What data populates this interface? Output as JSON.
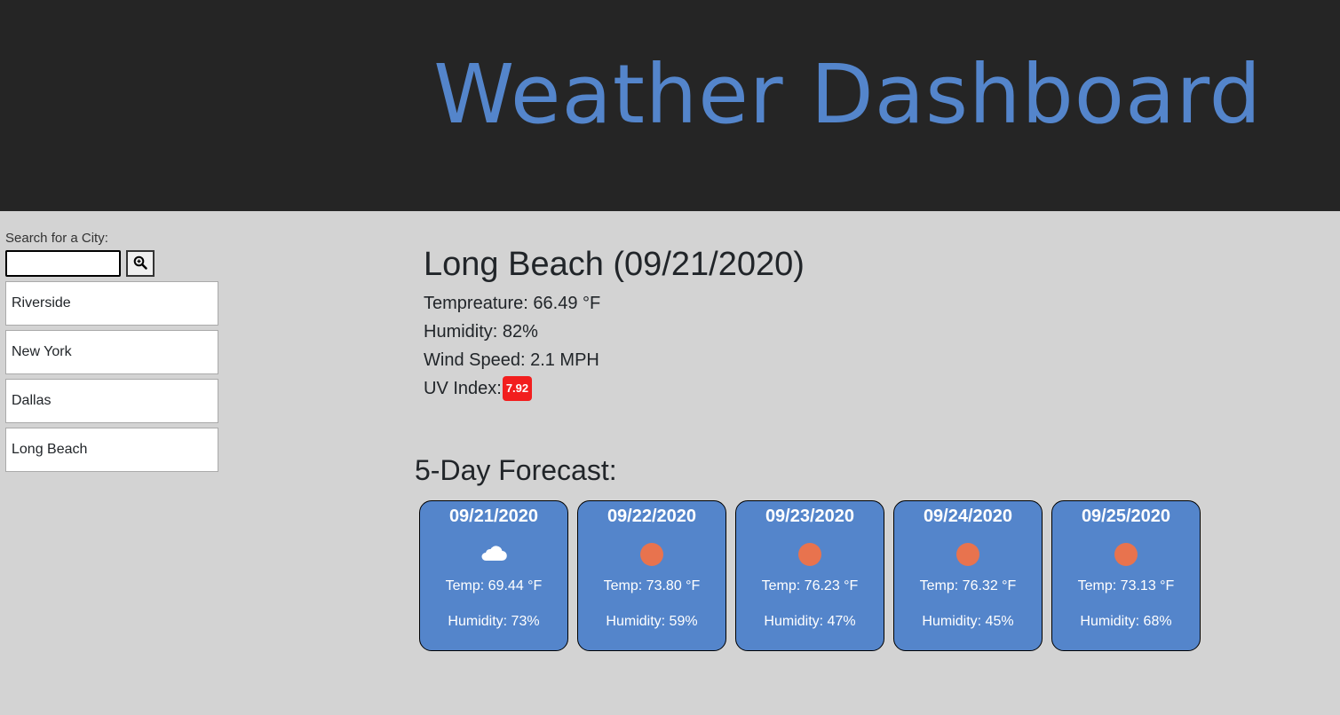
{
  "colors": {
    "header_bg": "#252525",
    "title": "#5485cb",
    "card_bg": "#5485cb",
    "uv_badge": "#f21e1e",
    "sun": "#e8734e",
    "page_bg": "#d3d3d3"
  },
  "header": {
    "title": "Weather Dashboard"
  },
  "search": {
    "label": "Search for a City:",
    "value": "",
    "placeholder": "",
    "button_icon": "search-icon"
  },
  "history": [
    "Riverside",
    "New York",
    "Dallas",
    "Long Beach"
  ],
  "current": {
    "heading": "Long Beach (09/21/2020)",
    "temperature": "Tempreature: 66.49 °F",
    "humidity": "Humidity: 82%",
    "wind": "Wind Speed: 2.1 MPH",
    "uv_label": "UV Index:",
    "uv_value": "7.92"
  },
  "forecast": {
    "title": "5-Day Forecast:",
    "days": [
      {
        "date": "09/21/2020",
        "icon": "cloud-icon",
        "temp": "Temp: 69.44 °F",
        "humidity": "Humidity: 73%"
      },
      {
        "date": "09/22/2020",
        "icon": "sun-icon",
        "temp": "Temp: 73.80 °F",
        "humidity": "Humidity: 59%"
      },
      {
        "date": "09/23/2020",
        "icon": "sun-icon",
        "temp": "Temp: 76.23 °F",
        "humidity": "Humidity: 47%"
      },
      {
        "date": "09/24/2020",
        "icon": "sun-icon",
        "temp": "Temp: 76.32 °F",
        "humidity": "Humidity: 45%"
      },
      {
        "date": "09/25/2020",
        "icon": "sun-icon",
        "temp": "Temp: 73.13 °F",
        "humidity": "Humidity: 68%"
      }
    ]
  }
}
